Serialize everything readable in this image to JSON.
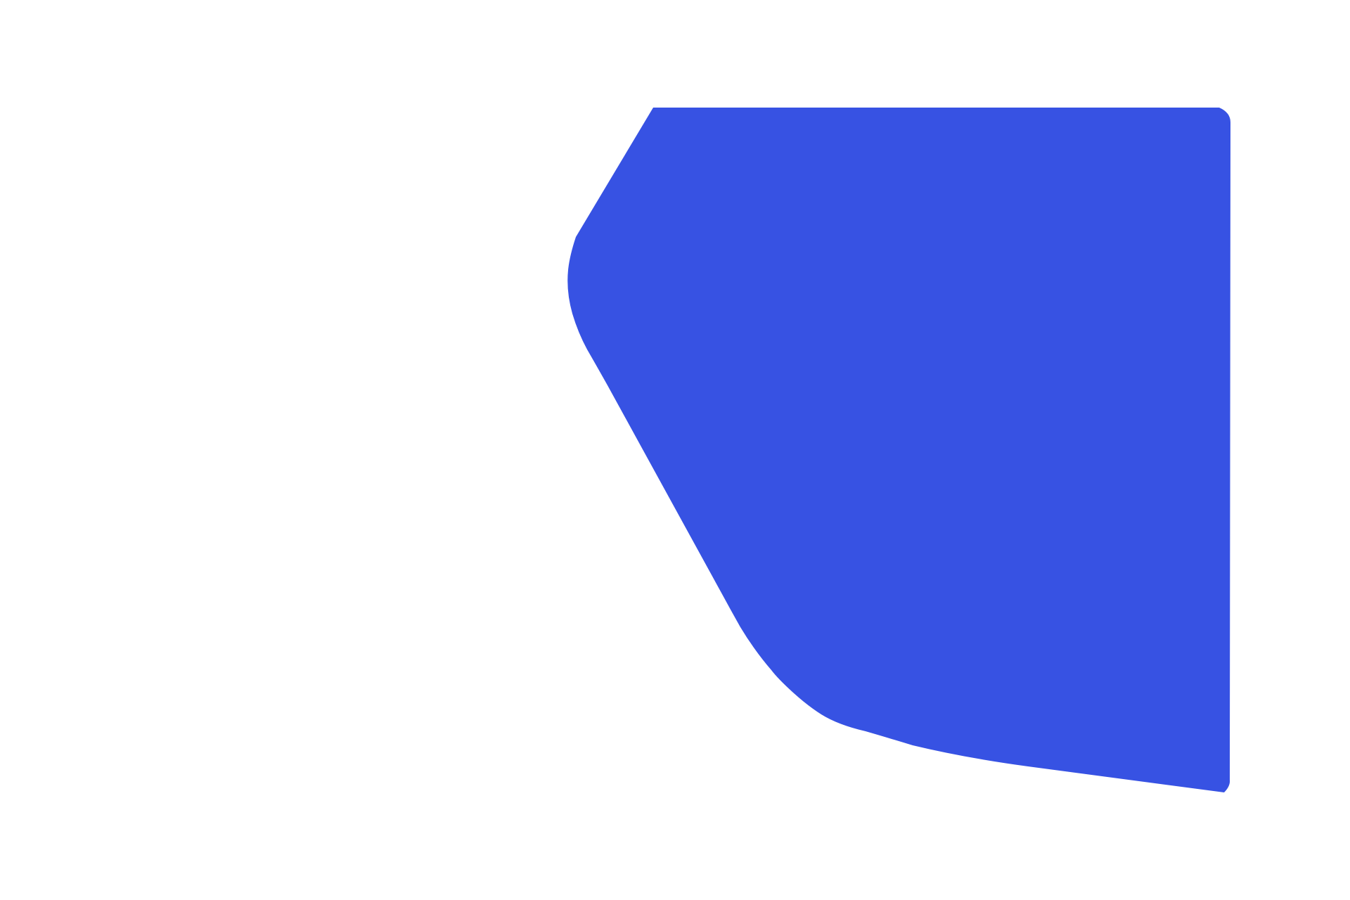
{
  "canvas": {
    "background_color": "#ffffff"
  },
  "shape": {
    "semantic": "blue-polygon-shape",
    "fill_color": "#3752e3"
  }
}
